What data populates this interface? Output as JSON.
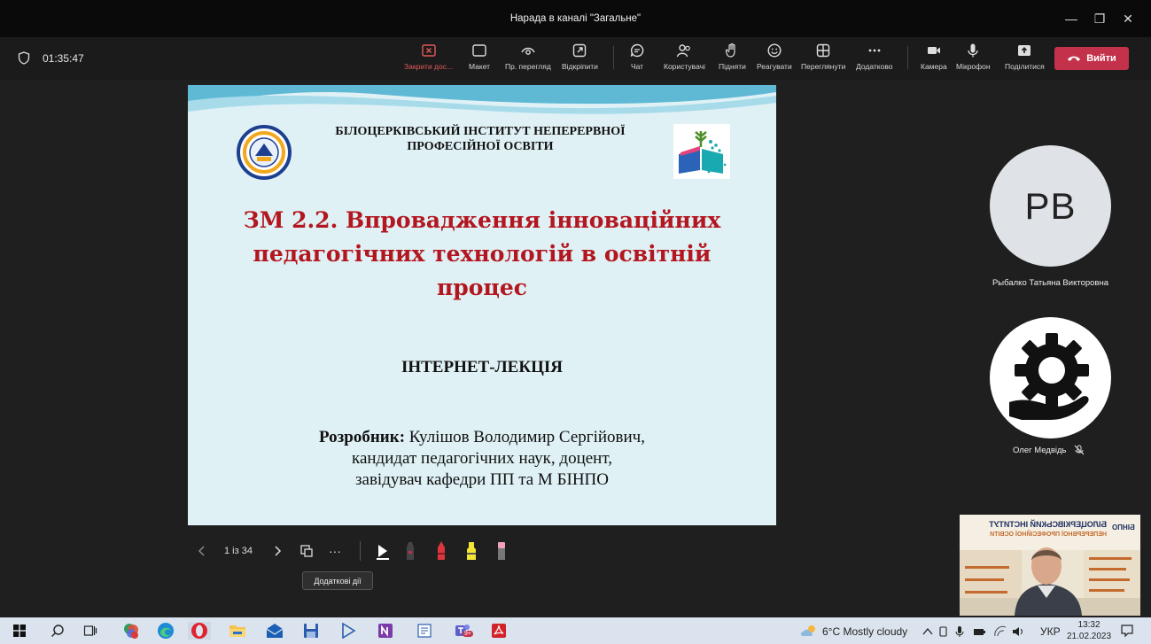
{
  "window": {
    "title": "Нарада в каналі \"Загальне\"",
    "minimize": "—",
    "maximize": "❐",
    "close": "✕"
  },
  "meeting": {
    "timer": "01:35:47",
    "buttons": {
      "stop_sharing": "Закрити дос...",
      "layout": "Макет",
      "preview": "Пр. перегляд",
      "detach": "Відкріпити",
      "chat": "Чат",
      "people": "Користувачі",
      "raise": "Підняти",
      "react": "Реагувати",
      "view": "Переглянути",
      "more": "Додатково",
      "camera": "Камера",
      "mic": "Мікрофон",
      "share": "Поділитися",
      "leave": "Вийти"
    }
  },
  "slide": {
    "institute": "БІЛОЦЕРКІВСЬКИЙ ІНСТИТУТ НЕПЕРЕРВНОЇ ПРОФЕСІЙНОЇ ОСВІТИ",
    "heading_line1": "ЗМ 2.2. Впровадження інноваційних",
    "heading_line2": "педагогічних технологій в освітній",
    "heading_line3": "процес",
    "subtitle": "ІНТЕРНЕТ-ЛЕКЦІЯ",
    "author_label": "Розробник:",
    "author_name": " Кулішов Володимир Сергійович,",
    "author_line2": "кандидат педагогічних наук, доцент,",
    "author_line3": "завідувач кафедри ПП та М БІНПО"
  },
  "slide_controls": {
    "page": "1 із 34",
    "more": "···",
    "tooltip": "Додаткові дії"
  },
  "participants": [
    {
      "initials": "РВ",
      "name": "Рыбалко Татьяна Викторовна"
    },
    {
      "name": "Олег Медвідь"
    }
  ],
  "self_video": {
    "banner_line1": "БІЛОЦЕРКІВСЬКИЙ ІНСТИТУТ",
    "banner_line2": "НЕПЕРЕРВНОЇ ПРОФЕСІЙНОЇ ОСВІТИ",
    "brand": "БІНПО"
  },
  "taskbar": {
    "weather": "6°C  Mostly cloudy",
    "lang": "УКР",
    "time": "13:32",
    "date": "21.02.2023",
    "badge": "9+"
  },
  "colors": {
    "leave": "#c4314b",
    "slide_bg": "#dff1f5",
    "heading": "#b3161f"
  }
}
